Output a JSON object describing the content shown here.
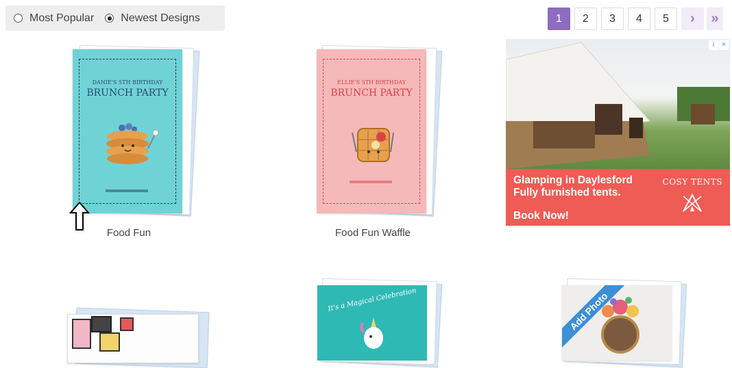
{
  "sort": {
    "options": [
      {
        "label": "Most Popular",
        "selected": false
      },
      {
        "label": "Newest Designs",
        "selected": true
      }
    ]
  },
  "pagination": {
    "pages": [
      "1",
      "2",
      "3",
      "4",
      "5"
    ],
    "current": "1",
    "next": "›",
    "last": "»"
  },
  "cards": [
    {
      "title": "Food Fun",
      "invite_line1": "DANIE'S 5TH BIRTHDAY",
      "invite_line2": "BRUNCH PARTY",
      "bg": "#6fd3d6",
      "text_color": "#2c4a72"
    },
    {
      "title": "Food Fun Waffle",
      "invite_line1": "ELLIE'S 5TH BIRTHDAY",
      "invite_line2": "BRUNCH PARTY",
      "bg": "#f4b9b8",
      "text_color": "#d9424b"
    },
    {
      "title": "",
      "invite_line1": "",
      "invite_line2": ""
    },
    {
      "title": "",
      "invite_line1": "It's a Magical Celebration",
      "invite_line2": "",
      "bg": "#2fb9b4"
    },
    {
      "title": "",
      "ribbon": "Add Photo"
    }
  ],
  "ad": {
    "headline_line1": "Glamping in Daylesford",
    "headline_line2": "Fully furnished tents.",
    "cta": "Book Now!",
    "brand": "COSY TENTS",
    "choices_icon": "i",
    "close_icon": "×",
    "banner_color": "#ee5c55"
  }
}
